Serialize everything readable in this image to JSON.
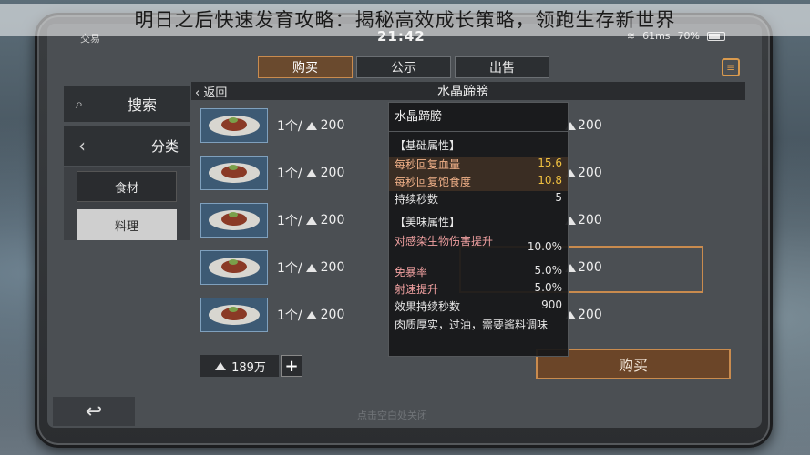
{
  "article_title": "明日之后快速发育攻略：揭秘高效成长策略，领跑生存新世界",
  "status": {
    "app": "交易",
    "time": "21:42",
    "signal": "61ms",
    "battery": "70%"
  },
  "tabs": [
    {
      "label": "购买"
    },
    {
      "label": "公示"
    },
    {
      "label": "出售"
    }
  ],
  "sidebar": {
    "search_label": "搜索",
    "category_label": "分类",
    "items": [
      {
        "label": "食材"
      },
      {
        "label": "料理"
      }
    ]
  },
  "header": {
    "back_label": "返回",
    "title": "水晶蹄膀"
  },
  "listings_left": [
    {
      "price": "1个/",
      "amount": "200"
    },
    {
      "price": "1个/",
      "amount": "200"
    },
    {
      "price": "1个/",
      "amount": "200"
    },
    {
      "price": "1个/",
      "amount": "200"
    },
    {
      "price": "1个/",
      "amount": "200"
    }
  ],
  "listings_right": [
    {
      "amount": "200"
    },
    {
      "amount": "200"
    },
    {
      "amount": "200"
    },
    {
      "amount": "200"
    },
    {
      "amount": "200"
    }
  ],
  "balance": {
    "value": "189万",
    "plus": "+"
  },
  "buy_button": "购买",
  "hint": "点击空白处关闭",
  "tooltip": {
    "title": "水晶蹄膀",
    "basic_section": "【基础属性】",
    "basic": [
      {
        "key": "每秒回复血量",
        "value": "15.6"
      },
      {
        "key": "每秒回复饱食度",
        "value": "10.8"
      },
      {
        "key": "持续秒数",
        "value": "5"
      }
    ],
    "taste_section": "【美味属性】",
    "taste": [
      {
        "key": "对感染生物伤害提升",
        "value": "10.0%"
      },
      {
        "key": "免暴率",
        "value": "5.0%"
      },
      {
        "key": "射速提升",
        "value": "5.0%"
      },
      {
        "key": "效果持续秒数",
        "value": "900"
      }
    ],
    "description": "肉质厚实，过油，需要酱料调味"
  },
  "colors": {
    "accent": "#c98b4e",
    "highlight_value": "#f0c040",
    "panel": "#2a2c2f"
  },
  "icons": [
    "search-icon",
    "chevron-left-icon",
    "back-arrow-icon",
    "coin-icon",
    "plus-icon",
    "menu-icon",
    "wifi-icon",
    "battery-icon"
  ]
}
